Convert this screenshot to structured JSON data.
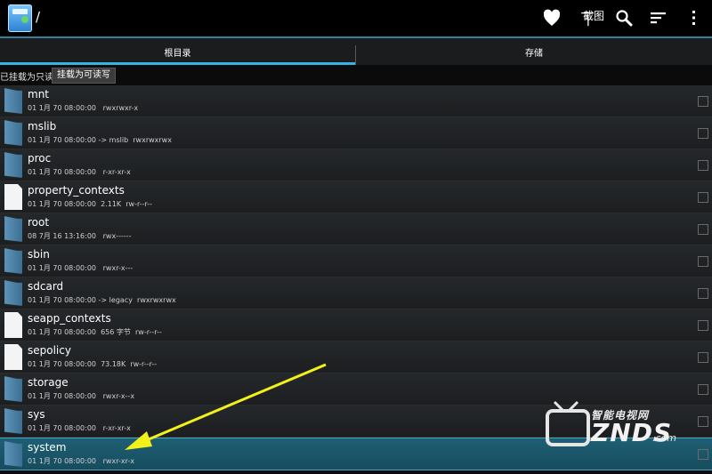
{
  "actionbar": {
    "path": "/",
    "icons": [
      "favorite-heart-icon",
      "screenshot-icon",
      "search-icon",
      "sort-icon",
      "overflow-menu-icon"
    ],
    "screenshot_label": "截图"
  },
  "tabs": [
    {
      "label": "根目录",
      "selected": true
    },
    {
      "label": "存储",
      "selected": false
    }
  ],
  "mountbar": {
    "status": "已挂载为只读",
    "button": "挂载为可读写"
  },
  "files": [
    {
      "name": "mnt",
      "type": "folder",
      "meta": "01 1月 70 08:00:00   rwxrwxr-x"
    },
    {
      "name": "mslib",
      "type": "folder",
      "meta": "01 1月 70 08:00:00 -> mslib  rwxrwxrwx"
    },
    {
      "name": "proc",
      "type": "folder",
      "meta": "01 1月 70 08:00:00   r-xr-xr-x"
    },
    {
      "name": "property_contexts",
      "type": "file",
      "meta": "01 1月 70 08:00:00  2.11K  rw-r--r--"
    },
    {
      "name": "root",
      "type": "folder",
      "meta": "08 7月 16 13:16:00   rwx------"
    },
    {
      "name": "sbin",
      "type": "folder",
      "meta": "01 1月 70 08:00:00   rwxr-x---"
    },
    {
      "name": "sdcard",
      "type": "folder",
      "meta": "01 1月 70 08:00:00 -> legacy  rwxrwxrwx"
    },
    {
      "name": "seapp_contexts",
      "type": "file",
      "meta": "01 1月 70 08:00:00  656 字节  rw-r--r--"
    },
    {
      "name": "sepolicy",
      "type": "file",
      "meta": "01 1月 70 08:00:00  73.18K  rw-r--r--"
    },
    {
      "name": "storage",
      "type": "folder",
      "meta": "01 1月 70 08:00:00   rwxr-x--x"
    },
    {
      "name": "sys",
      "type": "folder",
      "meta": "01 1月 70 08:00:00   r-xr-xr-x"
    },
    {
      "name": "system",
      "type": "folder",
      "meta": "01 1月 70 08:00:00   rwxr-xr-x",
      "selected": true
    }
  ],
  "watermark": {
    "brand": "智能电视网",
    "main": "ZNDS",
    "suffix": ".com"
  },
  "colors": {
    "accent": "#33b5e5",
    "arrow": "#f2f21a",
    "selected_row": "#1f5f74"
  }
}
